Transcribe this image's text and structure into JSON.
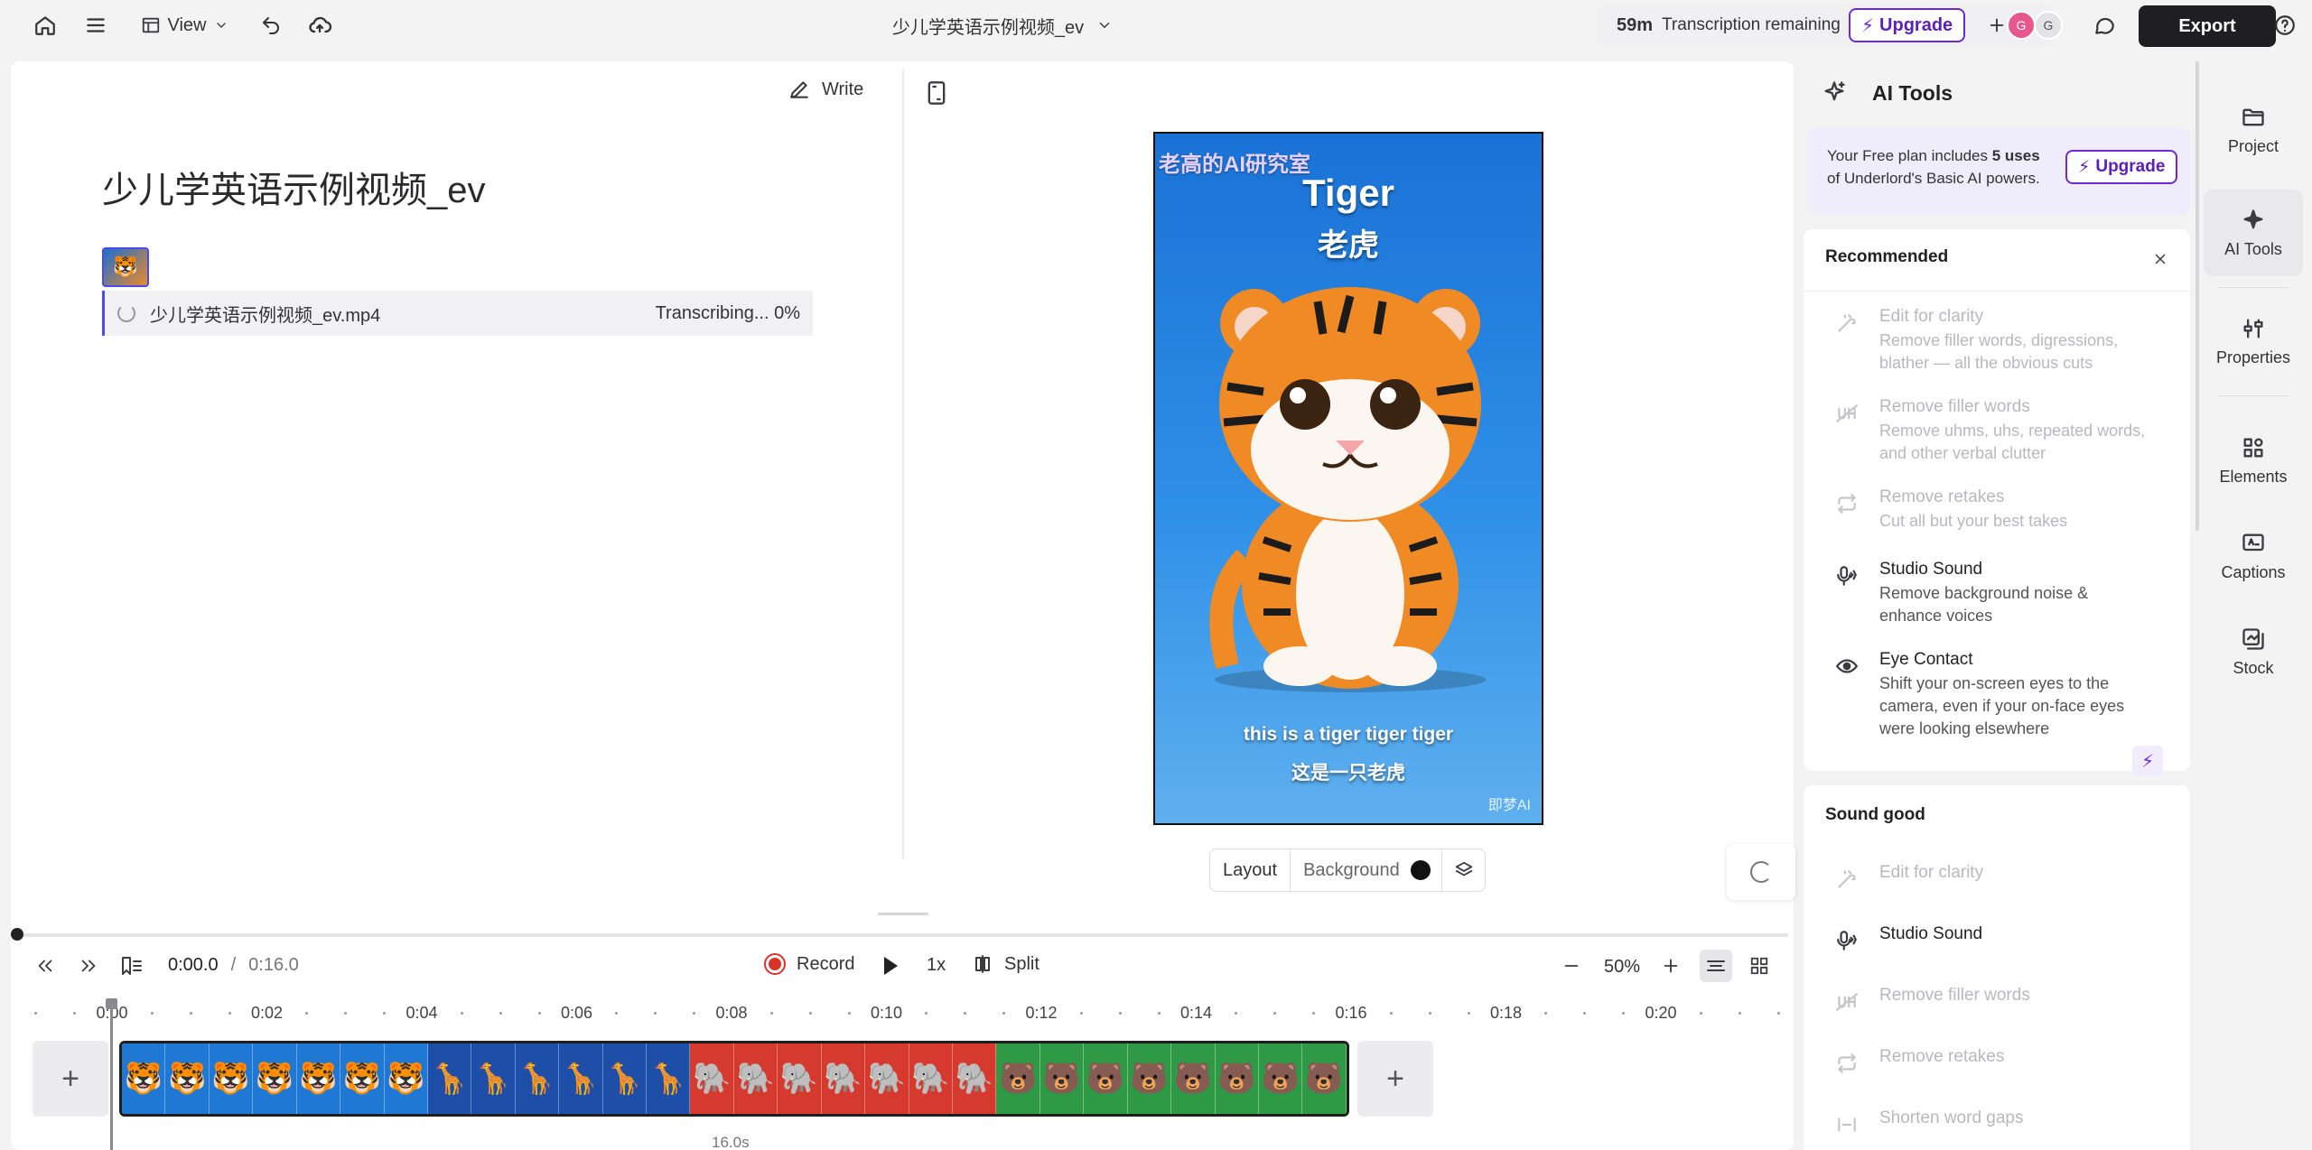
{
  "topbar": {
    "view_label": "View",
    "project_name": "少儿学英语示例视频_ev",
    "transcription_minutes": "59m",
    "transcription_label": "Transcription remaining",
    "upgrade_label": "Upgrade",
    "avatar_1": "G",
    "avatar_2": "G",
    "export_label": "Export"
  },
  "script": {
    "write_label": "Write",
    "title": "少儿学英语示例视频_ev",
    "file_name": "少儿学英语示例视频_ev.mp4",
    "status": "Transcribing... 0%"
  },
  "video": {
    "watermark": "老高的AI研究室",
    "title_en": "Tiger",
    "title_zh": "老虎",
    "subtitle_en": "this is a tiger tiger tiger",
    "subtitle_zh": "这是一只老虎",
    "logo_text": "即梦AI"
  },
  "preview_controls": {
    "layout_label": "Layout",
    "background_label": "Background",
    "background_color": "#111111"
  },
  "ai_panel": {
    "title": "AI Tools",
    "plan_text_1": "Your Free plan includes ",
    "plan_text_bold": "5 uses",
    "plan_text_2": " of Underlord's Basic AI powers.",
    "upgrade_label": "Upgrade",
    "recommended_title": "Recommended",
    "recommended": [
      {
        "title": "Edit for clarity",
        "desc": "Remove filler words, digressions, blather — all the obvious cuts",
        "icon": "wand-icon",
        "disabled": true
      },
      {
        "title": "Remove filler words",
        "desc": "Remove uhms, uhs, repeated words, and other verbal clutter",
        "icon": "filler-icon",
        "disabled": true
      },
      {
        "title": "Remove retakes",
        "desc": "Cut all but your best takes",
        "icon": "retake-icon",
        "disabled": true
      },
      {
        "title": "Studio Sound",
        "desc": "Remove background noise & enhance voices",
        "icon": "mic-icon",
        "disabled": false
      },
      {
        "title": "Eye Contact",
        "desc": "Shift your on-screen eyes to the camera, even if your on-face eyes were looking elsewhere",
        "icon": "eye-icon",
        "disabled": false
      }
    ],
    "sound_good_title": "Sound good",
    "sound_good": [
      {
        "title": "Edit for clarity",
        "icon": "wand-icon",
        "disabled": true
      },
      {
        "title": "Studio Sound",
        "icon": "mic-icon",
        "disabled": false
      },
      {
        "title": "Remove filler words",
        "icon": "filler-icon",
        "disabled": true
      },
      {
        "title": "Remove retakes",
        "icon": "retake-icon",
        "disabled": true
      },
      {
        "title": "Shorten word gaps",
        "icon": "gap-icon",
        "disabled": true
      }
    ]
  },
  "rail": [
    {
      "label": "Project",
      "icon": "folder-icon"
    },
    {
      "label": "AI Tools",
      "icon": "sparkle-icon"
    },
    {
      "label": "Properties",
      "icon": "sliders-icon"
    },
    {
      "label": "Elements",
      "icon": "elements-icon"
    },
    {
      "label": "Captions",
      "icon": "captions-icon"
    },
    {
      "label": "Stock",
      "icon": "stock-icon"
    }
  ],
  "transport": {
    "current_time": "0:00.0",
    "separator": "/",
    "total_time": "0:16.0",
    "record_label": "Record",
    "speed_label": "1x",
    "split_label": "Split",
    "zoom_label": "50%"
  },
  "timeline": {
    "ruler": [
      "0:00",
      "0:02",
      "0:04",
      "0:06",
      "0:08",
      "0:10",
      "0:12",
      "0:14",
      "0:16",
      "0:18",
      "0:20"
    ],
    "duration_label": "16.0s",
    "clip_groups": [
      {
        "animal": "tiger",
        "count": 7,
        "color": "#1f78d4"
      },
      {
        "animal": "giraffe",
        "count": 6,
        "color": "#1d4fa8"
      },
      {
        "animal": "elephant",
        "count": 7,
        "color": "#d63a2f"
      },
      {
        "animal": "bear",
        "count": 8,
        "color": "#2f9a45"
      }
    ]
  }
}
